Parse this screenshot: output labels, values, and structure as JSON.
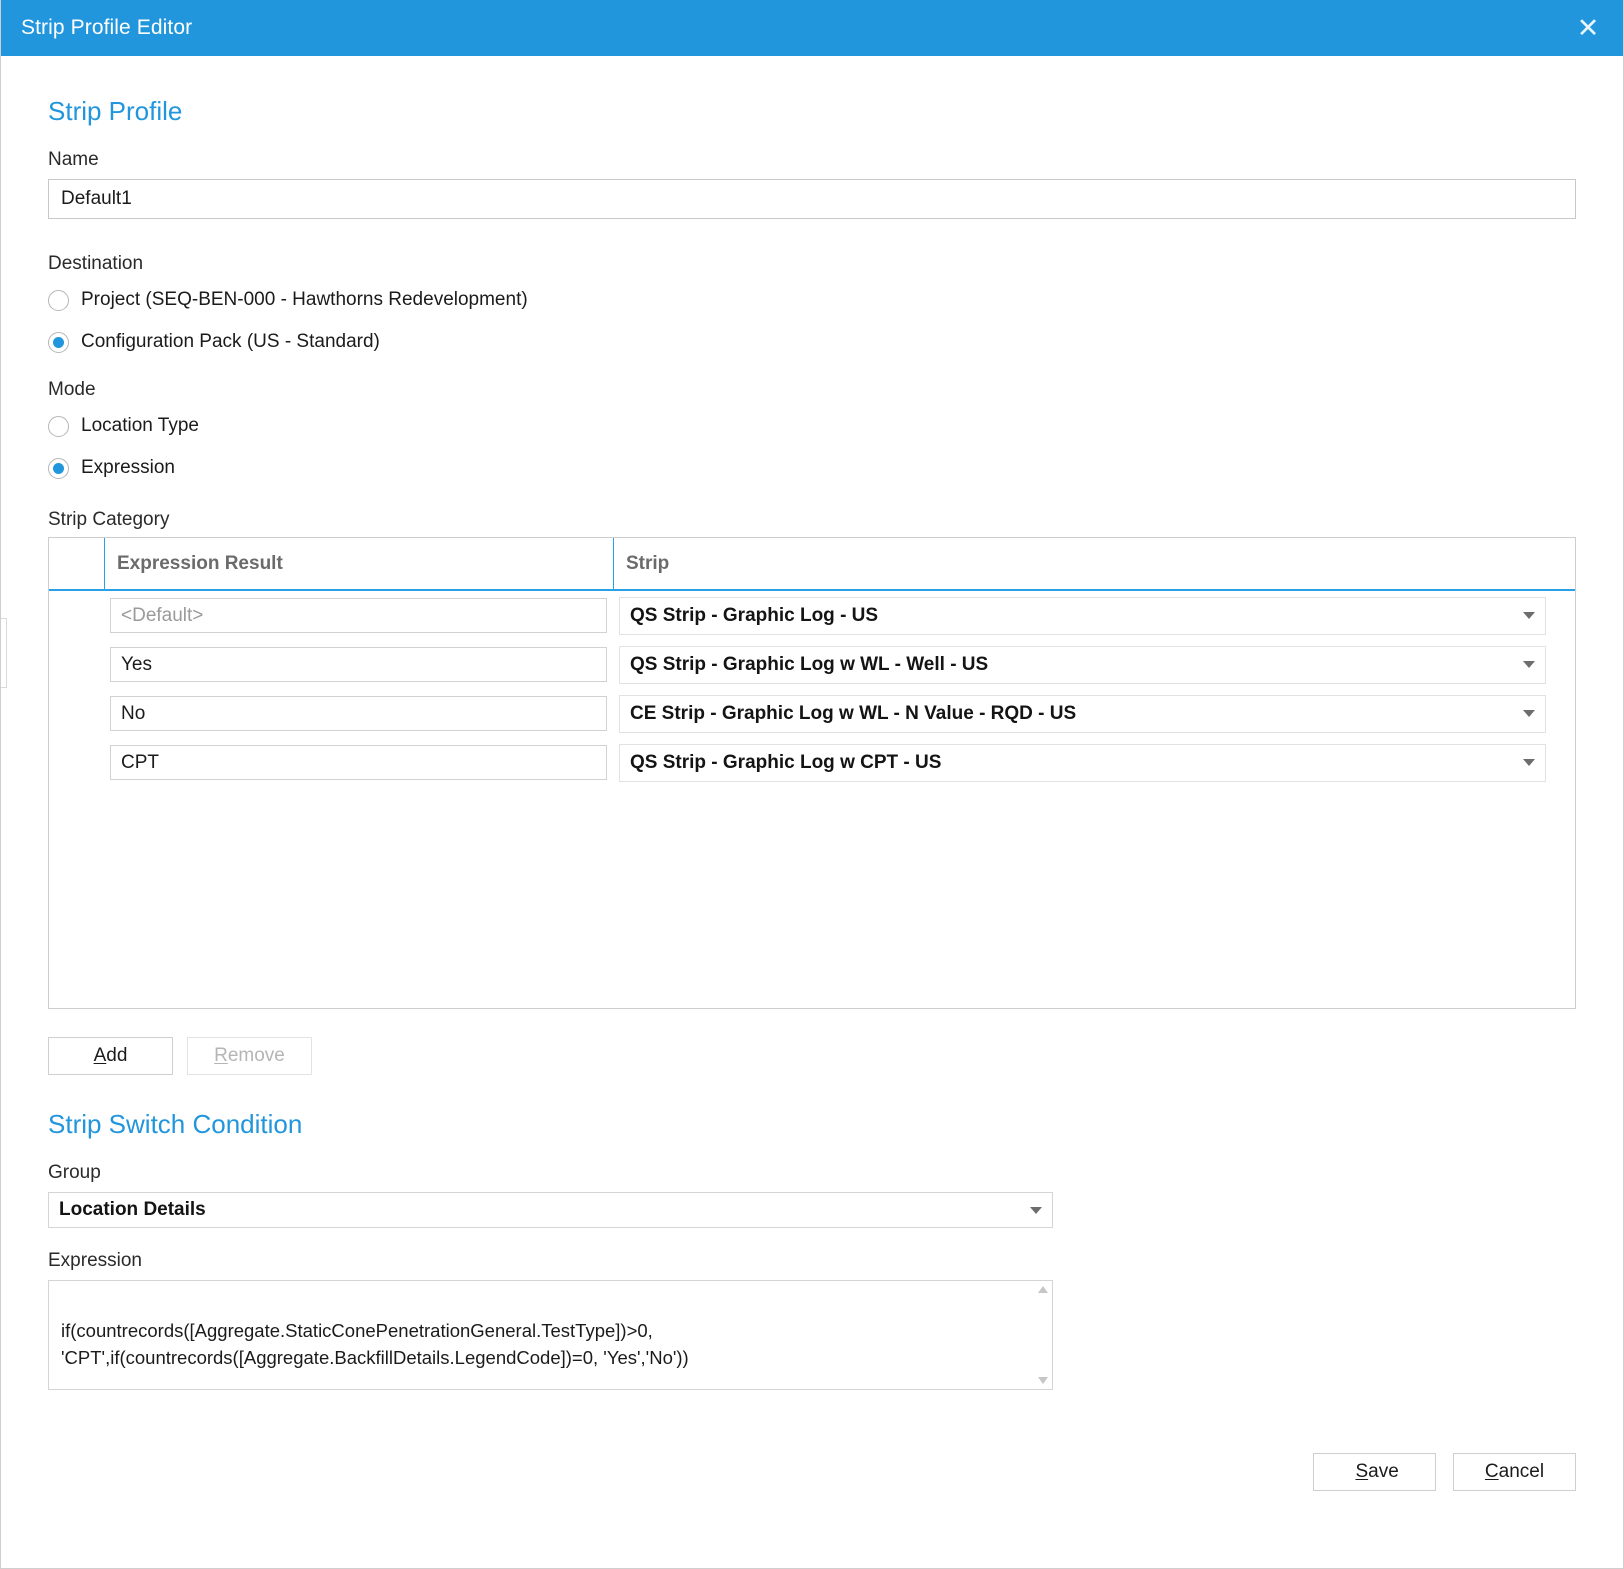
{
  "window": {
    "title": "Strip Profile Editor",
    "close_icon": "close-icon",
    "accent_color": "#2196dd",
    "header_bg": "#2196dd"
  },
  "strip_profile": {
    "section_title": "Strip Profile",
    "name_label": "Name",
    "name_value": "Default1",
    "destination_label": "Destination",
    "destination_options": [
      {
        "label": "Project (SEQ-BEN-000 - Hawthorns Redevelopment)",
        "selected": false
      },
      {
        "label": "Configuration Pack (US - Standard)",
        "selected": true
      }
    ],
    "mode_label": "Mode",
    "mode_options": [
      {
        "label": "Location Type",
        "selected": false
      },
      {
        "label": "Expression",
        "selected": true
      }
    ]
  },
  "strip_category": {
    "label": "Strip Category",
    "columns": [
      "",
      "Expression Result",
      "Strip"
    ],
    "rows": [
      {
        "expression_result": "",
        "expression_placeholder": "<Default>",
        "strip": "QS Strip - Graphic Log - US"
      },
      {
        "expression_result": "Yes",
        "expression_placeholder": "",
        "strip": "QS Strip - Graphic Log w WL - Well - US"
      },
      {
        "expression_result": "No",
        "expression_placeholder": "",
        "strip": "CE Strip - Graphic Log w WL - N Value - RQD - US"
      },
      {
        "expression_result": "CPT",
        "expression_placeholder": "",
        "strip": "QS Strip - Graphic Log w CPT - US"
      }
    ],
    "add_button": "Add",
    "add_accel": "A",
    "remove_button": "Remove",
    "remove_accel": "R"
  },
  "strip_switch_condition": {
    "section_title": "Strip Switch Condition",
    "group_label": "Group",
    "group_value": "Location Details",
    "expression_label": "Expression",
    "expression_value": "if(countrecords([Aggregate.StaticConePenetrationGeneral.TestType])>0,                          'CPT',if(countrecords([Aggregate.BackfillDetails.LegendCode])=0, 'Yes','No'))"
  },
  "footer": {
    "save_button": "Save",
    "save_accel": "S",
    "cancel_button": "Cancel",
    "cancel_accel": "C"
  }
}
